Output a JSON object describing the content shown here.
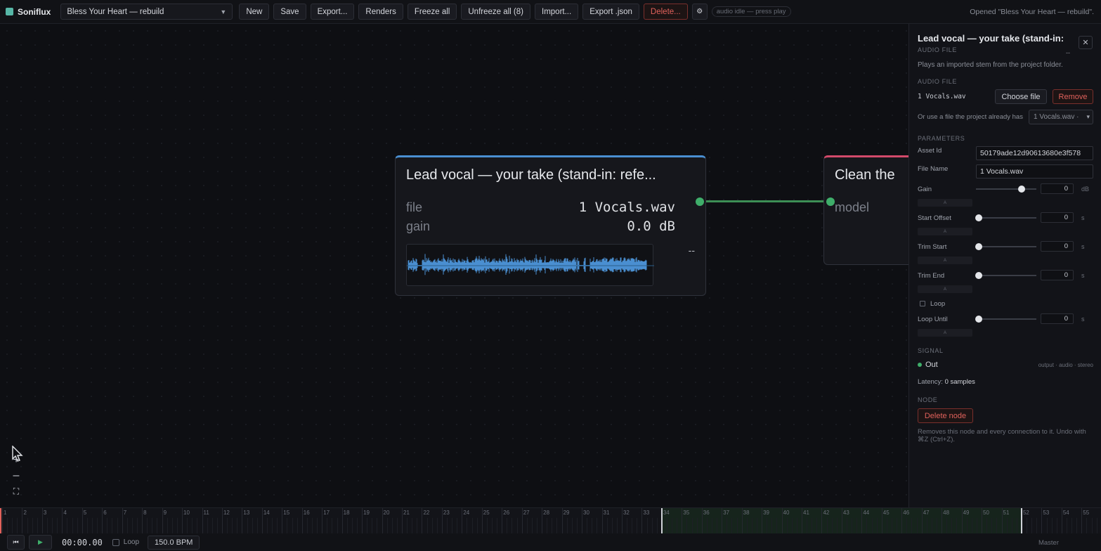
{
  "app": {
    "brand": "Soniflux",
    "brand_color": "#57b7a7"
  },
  "toolbar": {
    "project": "Bless Your Heart — rebuild",
    "new": "New",
    "save": "Save",
    "export": "Export...",
    "renders": "Renders",
    "freeze_all": "Freeze all",
    "unfreeze_all": "Unfreeze all (8)",
    "import": "Import...",
    "export_json": "Export .json",
    "delete": "Delete...",
    "settings_icon": "gear-icon",
    "audio_status": "audio idle — press play",
    "status_message": "Opened \"Bless Your Heart — rebuild\"."
  },
  "canvas": {
    "node_a": {
      "title": "Lead vocal — your take (stand-in: refe...",
      "file_label": "file",
      "file_value": "1 Vocals.wav",
      "gain_label": "gain",
      "gain_value": "0.0 dB",
      "meter": "--",
      "accent": "#4a8fd1"
    },
    "node_b": {
      "title": "Clean the",
      "model_label": "model",
      "accent": "#d24a6a"
    },
    "zoom_in": "+",
    "zoom_out": "–",
    "fit": "⛶"
  },
  "inspector": {
    "title": "Lead vocal — your take (stand-in: re",
    "type": "AUDIO FILE",
    "small_dash": "--",
    "description": "Plays an imported stem from the project folder.",
    "audio_file_section": "AUDIO FILE",
    "file_name": "1 Vocals.wav",
    "choose_file": "Choose file",
    "remove": "Remove",
    "existing_label": "Or use a file the project already has",
    "existing_value": "1 Vocals.wav ·",
    "params_section": "PARAMETERS",
    "asset_id_label": "Asset Id",
    "asset_id_value": "50179ade12d90613680e3f578",
    "file_name_label": "File Name",
    "file_name_value": "1 Vocals.wav",
    "gain_label": "Gain",
    "gain_value": "0",
    "gain_unit": "dB",
    "gain_level": 0.75,
    "start_offset_label": "Start Offset",
    "start_offset_value": "0",
    "trim_start_label": "Trim Start",
    "trim_start_value": "0",
    "trim_end_label": "Trim End",
    "trim_end_value": "0",
    "loop_label": "Loop",
    "loop_until_label": "Loop Until",
    "loop_until_value": "0",
    "sec_unit": "s",
    "auto": "A",
    "signal_section": "SIGNAL",
    "out_label": "Out",
    "out_meta": "output · audio · stereo",
    "latency_label": "Latency:",
    "latency_value": "0 samples",
    "node_section": "NODE",
    "delete_node": "Delete node",
    "delete_note": "Removes this node and every connection to it. Undo with ⌘Z (Ctrl+Z)."
  },
  "timeline": {
    "bars": [
      "1",
      "2",
      "3",
      "4",
      "5",
      "6",
      "7",
      "8",
      "9",
      "10",
      "11",
      "12",
      "13",
      "14",
      "15",
      "16",
      "17",
      "18",
      "19",
      "20",
      "21",
      "22",
      "23",
      "24",
      "25",
      "26",
      "27",
      "28",
      "29",
      "30",
      "31",
      "32",
      "33",
      "34",
      "35",
      "36",
      "37",
      "38",
      "39",
      "40",
      "41",
      "42",
      "43",
      "44",
      "45",
      "46",
      "47",
      "48",
      "49",
      "50",
      "51",
      "52",
      "53",
      "54",
      "55"
    ],
    "loop_start_bar": 34,
    "loop_end_bar": 52
  },
  "transport": {
    "rewind": "⏮",
    "play": "▶",
    "timecode": "00:00.00",
    "loop": "Loop",
    "bpm": "150.0 BPM",
    "master": "Master"
  }
}
